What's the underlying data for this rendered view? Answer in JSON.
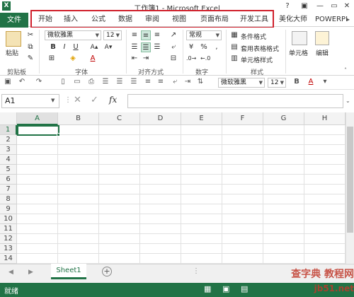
{
  "window": {
    "title": "工作簿1 - Microsoft Excel",
    "help": "?",
    "minimize": "—",
    "restore": "▭",
    "close": "✕"
  },
  "tabs": {
    "file": "文件",
    "items": [
      "开始",
      "插入",
      "公式",
      "数据",
      "审阅",
      "视图",
      "页面布局",
      "开发工具",
      "美化大师",
      "POWERPIV"
    ]
  },
  "ribbon": {
    "clipboard": {
      "paste": "粘贴",
      "group": "剪贴板"
    },
    "font": {
      "name": "微软雅黑",
      "size": "12",
      "bold": "B",
      "italic": "I",
      "underline": "U",
      "group": "字体"
    },
    "alignment": {
      "group": "对齐方式"
    },
    "number": {
      "format": "常规",
      "percent": "%",
      "comma": ",",
      "group": "数字"
    },
    "styles": {
      "conditional": "条件格式",
      "table": "套用表格格式",
      "cell_styles": "单元格样式",
      "group": "样式"
    },
    "cells": {
      "label": "单元格"
    },
    "editing": {
      "label": "编辑"
    }
  },
  "qat": {
    "font": "微软雅黑",
    "size": "12"
  },
  "formula_bar": {
    "name_box": "A1",
    "fx": "fx",
    "cancel": "✕",
    "enter": "✓"
  },
  "grid": {
    "columns": [
      "A",
      "B",
      "C",
      "D",
      "E",
      "F",
      "G",
      "H"
    ],
    "rows": [
      "1",
      "2",
      "3",
      "4",
      "5",
      "6",
      "7",
      "8",
      "9",
      "10",
      "11",
      "12",
      "13",
      "14"
    ]
  },
  "sheets": {
    "tab": "Sheet1",
    "add": "+"
  },
  "status": {
    "ready": "就绪"
  },
  "watermark": {
    "line1": "查字典 教程网",
    "line2": "jb51.net"
  },
  "colors": {
    "accent": "#217346",
    "highlight": "#d0202c"
  }
}
